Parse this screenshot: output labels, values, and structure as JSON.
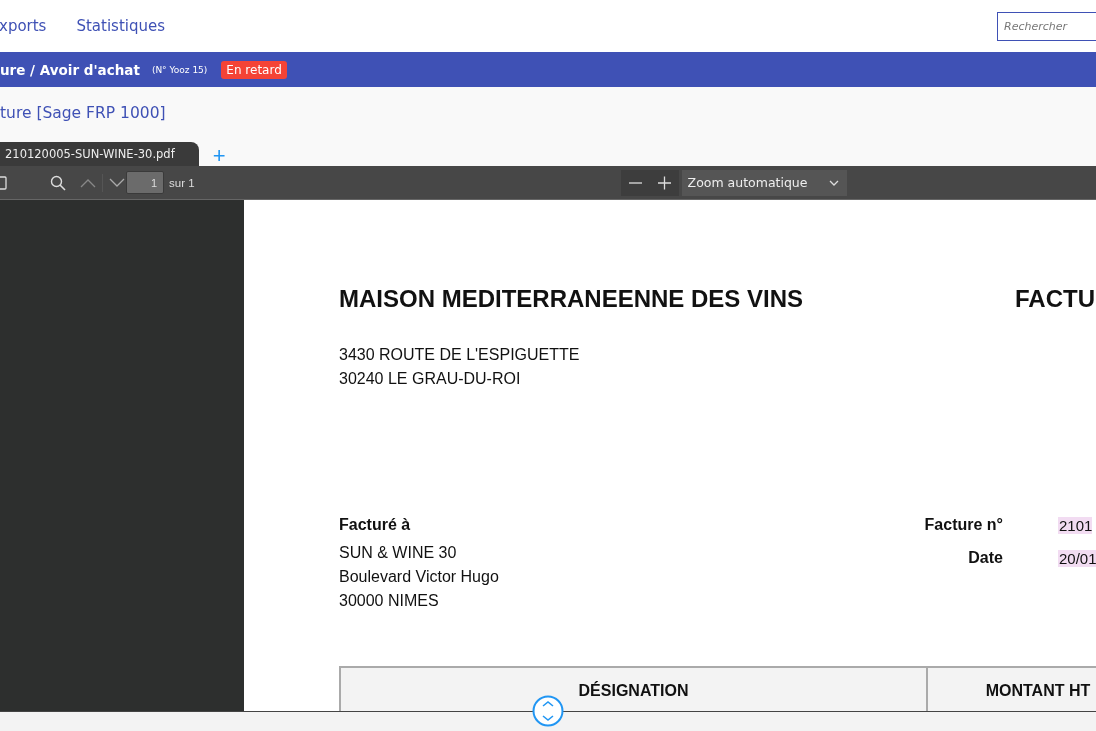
{
  "nav": {
    "items": [
      "xports",
      "Statistiques"
    ],
    "search": {
      "placeholder": "Rechercher"
    }
  },
  "header": {
    "title": "ure / Avoir d'achat",
    "number": "(N° Yooz 15)",
    "badge": "En retard"
  },
  "section": {
    "title": "ture [Sage FRP 1000]"
  },
  "file_tabs": [
    {
      "label": "210120005-SUN-WINE-30.pdf",
      "selected": true
    }
  ],
  "add_tab": "+",
  "pdf_toolbar": {
    "page": "1",
    "page_count": "sur 1",
    "zoom": "Zoom automatique"
  },
  "document": {
    "company": "MAISON MEDITERRANEENNE DES VINS",
    "doc_type": "FACTU",
    "address": [
      "3430 ROUTE DE L'ESPIGUETTE",
      "30240 LE GRAU-DU-ROI"
    ],
    "bill_to_label": "Facturé à",
    "bill_to": [
      "SUN & WINE 30",
      "Boulevard Victor Hugo",
      "30000 NIMES"
    ],
    "fields": [
      {
        "label": "Facture n°",
        "value": "2101"
      },
      {
        "label": "Date",
        "value": "20/01"
      }
    ],
    "table_columns": [
      "DÉSIGNATION",
      "MONTANT HT"
    ]
  }
}
